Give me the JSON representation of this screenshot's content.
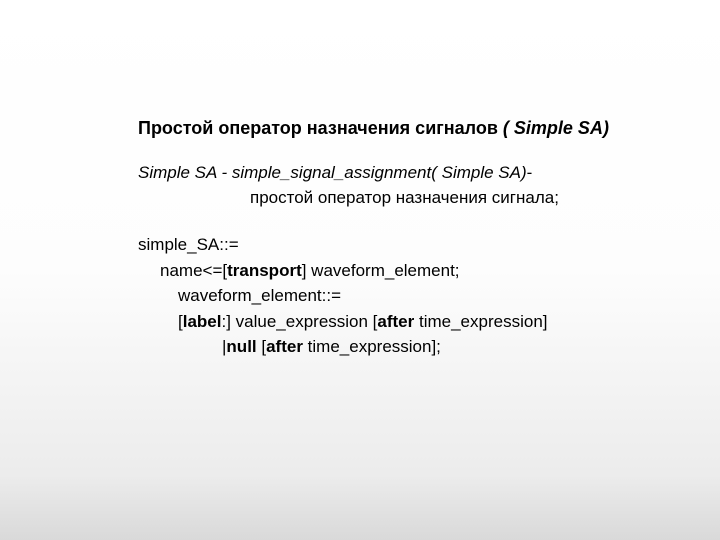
{
  "title": {
    "main": "Простой оператор назначения сигналов",
    "paren": "( Simple SA)"
  },
  "desc": {
    "l1_prefix": "Simple SA - simple_signal_assignment( Simple SA)",
    "l1_suffix": "-",
    "l2": "простой оператор назначения сигнала;"
  },
  "syntax": {
    "l1": "simple_SA::=",
    "l2_a": "name<=[",
    "l2_b": "transport",
    "l2_c": "] waveform_element;",
    "l3": "waveform_element::=",
    "l4_a": "[",
    "l4_b": "label",
    "l4_c": ":] value_expression [",
    "l4_d": "after",
    "l4_e": " time_expression]",
    "l5_a": "|",
    "l5_b": "null",
    "l5_c": " [",
    "l5_d": "after",
    "l5_e": " time_expression];"
  }
}
